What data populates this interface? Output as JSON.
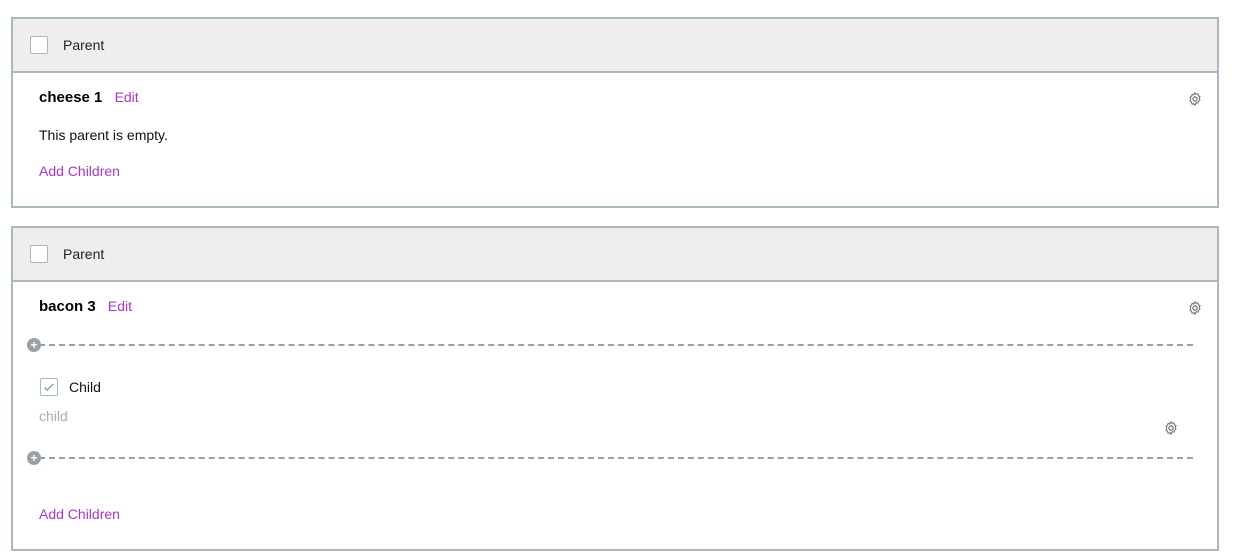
{
  "cards": [
    {
      "header_label": "Parent",
      "title": "cheese 1",
      "edit_label": "Edit",
      "empty_text": "This parent is empty.",
      "add_children_label": "Add Children"
    },
    {
      "header_label": "Parent",
      "title": "bacon 3",
      "edit_label": "Edit",
      "child": {
        "label": "Child",
        "sublabel": "child",
        "checked": true
      },
      "add_children_label": "Add Children"
    }
  ],
  "icons": {
    "gear": "gear-icon",
    "plus": "plus-circle-icon",
    "check": "checkmark-icon"
  },
  "colors": {
    "accent": "#a637c9",
    "border": "#aab8c2",
    "header_bg": "#eeeeee",
    "muted": "#9fb0bd"
  }
}
